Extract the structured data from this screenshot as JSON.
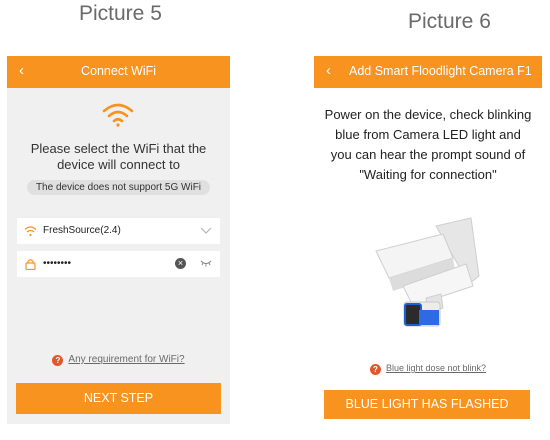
{
  "captions": {
    "left": "Picture 5",
    "right": "Picture 6"
  },
  "screen1": {
    "back_icon": "‹",
    "title": "Connect WiFi",
    "heading": "Please select the WiFi that the device will connect to",
    "notice": "The device does not support 5G WiFi",
    "ssid": "FreshSource(2.4)",
    "password_masked": "••••••••",
    "help_link": "Any requirement for WiFi?",
    "next_button": "NEXT STEP"
  },
  "screen2": {
    "back_icon": "‹",
    "title": "Add Smart Floodlight Camera F1",
    "instructions": "Power on the device, check blinking blue from Camera LED light and you can hear the prompt sound of \"Waiting for connection\"",
    "help_link": "Blue light dose not blink?",
    "confirm_button": "BLUE LIGHT HAS FLASHED"
  },
  "colors": {
    "accent": "#f7931e",
    "help_icon": "#e4572e"
  }
}
